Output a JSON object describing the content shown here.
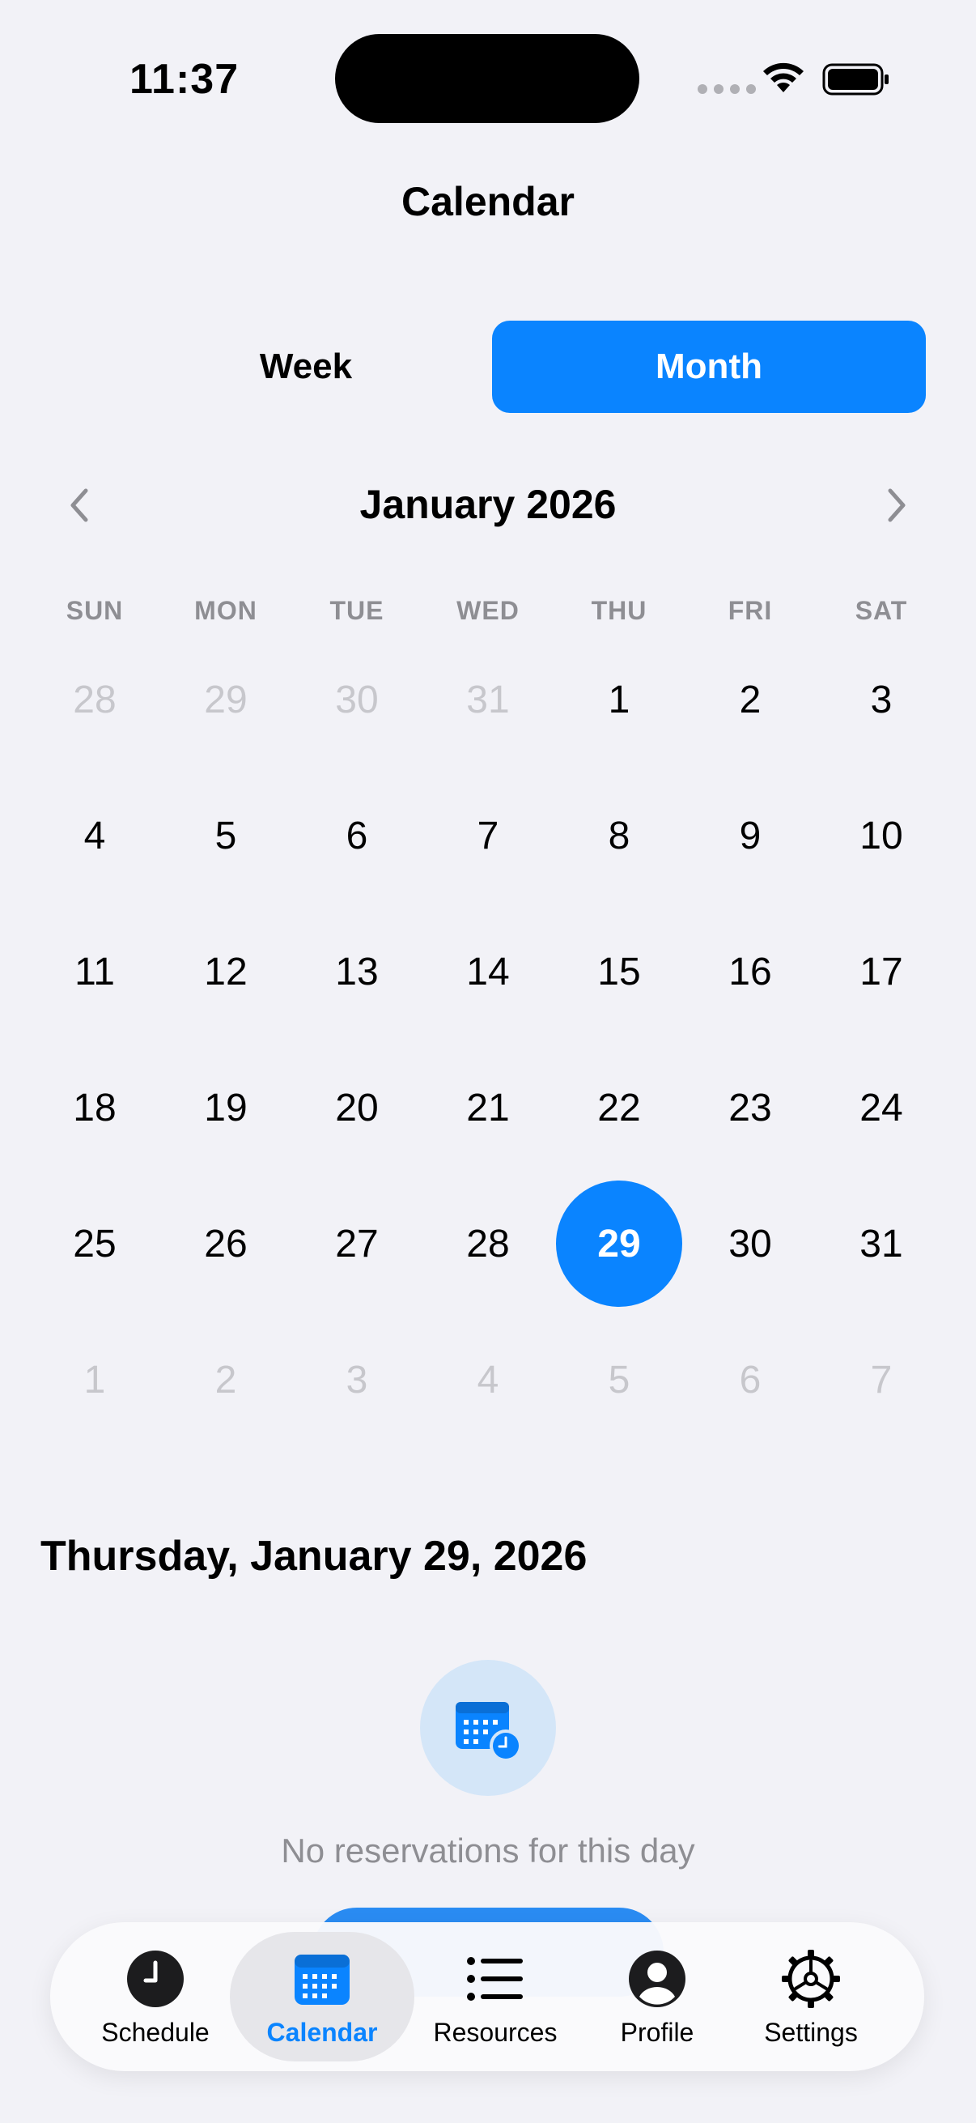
{
  "status_bar": {
    "time": "11:37"
  },
  "nav": {
    "title": "Calendar"
  },
  "segment": {
    "week_label": "Week",
    "month_label": "Month",
    "selected": "Month"
  },
  "month_header": {
    "label": "January 2026"
  },
  "weekdays": [
    "SUN",
    "MON",
    "TUE",
    "WED",
    "THU",
    "FRI",
    "SAT"
  ],
  "days": [
    {
      "n": "28",
      "muted": true
    },
    {
      "n": "29",
      "muted": true
    },
    {
      "n": "30",
      "muted": true
    },
    {
      "n": "31",
      "muted": true
    },
    {
      "n": "1"
    },
    {
      "n": "2"
    },
    {
      "n": "3"
    },
    {
      "n": "4"
    },
    {
      "n": "5"
    },
    {
      "n": "6"
    },
    {
      "n": "7"
    },
    {
      "n": "8"
    },
    {
      "n": "9"
    },
    {
      "n": "10"
    },
    {
      "n": "11"
    },
    {
      "n": "12"
    },
    {
      "n": "13"
    },
    {
      "n": "14"
    },
    {
      "n": "15"
    },
    {
      "n": "16"
    },
    {
      "n": "17"
    },
    {
      "n": "18"
    },
    {
      "n": "19"
    },
    {
      "n": "20"
    },
    {
      "n": "21"
    },
    {
      "n": "22"
    },
    {
      "n": "23"
    },
    {
      "n": "24"
    },
    {
      "n": "25"
    },
    {
      "n": "26"
    },
    {
      "n": "27"
    },
    {
      "n": "28"
    },
    {
      "n": "29",
      "selected": true
    },
    {
      "n": "30"
    },
    {
      "n": "31"
    },
    {
      "n": "1",
      "muted": true
    },
    {
      "n": "2",
      "muted": true
    },
    {
      "n": "3",
      "muted": true
    },
    {
      "n": "4",
      "muted": true
    },
    {
      "n": "5",
      "muted": true
    },
    {
      "n": "6",
      "muted": true
    },
    {
      "n": "7",
      "muted": true
    }
  ],
  "selected_day": {
    "label": "Thursday, January 29, 2026"
  },
  "empty_state": {
    "icon": "calendar-clock-icon",
    "message": "No reservations for this day"
  },
  "tab_bar": {
    "tabs": [
      {
        "label": "Schedule",
        "icon": "clock-icon"
      },
      {
        "label": "Calendar",
        "icon": "calendar-icon",
        "active": true
      },
      {
        "label": "Resources",
        "icon": "list-icon"
      },
      {
        "label": "Profile",
        "icon": "person-icon"
      },
      {
        "label": "Settings",
        "icon": "gear-icon"
      }
    ]
  },
  "colors": {
    "accent": "#0a84ff",
    "background": "#f2f2f7",
    "muted_text": "#8e8e93",
    "muted_day": "#c7c7cc"
  }
}
